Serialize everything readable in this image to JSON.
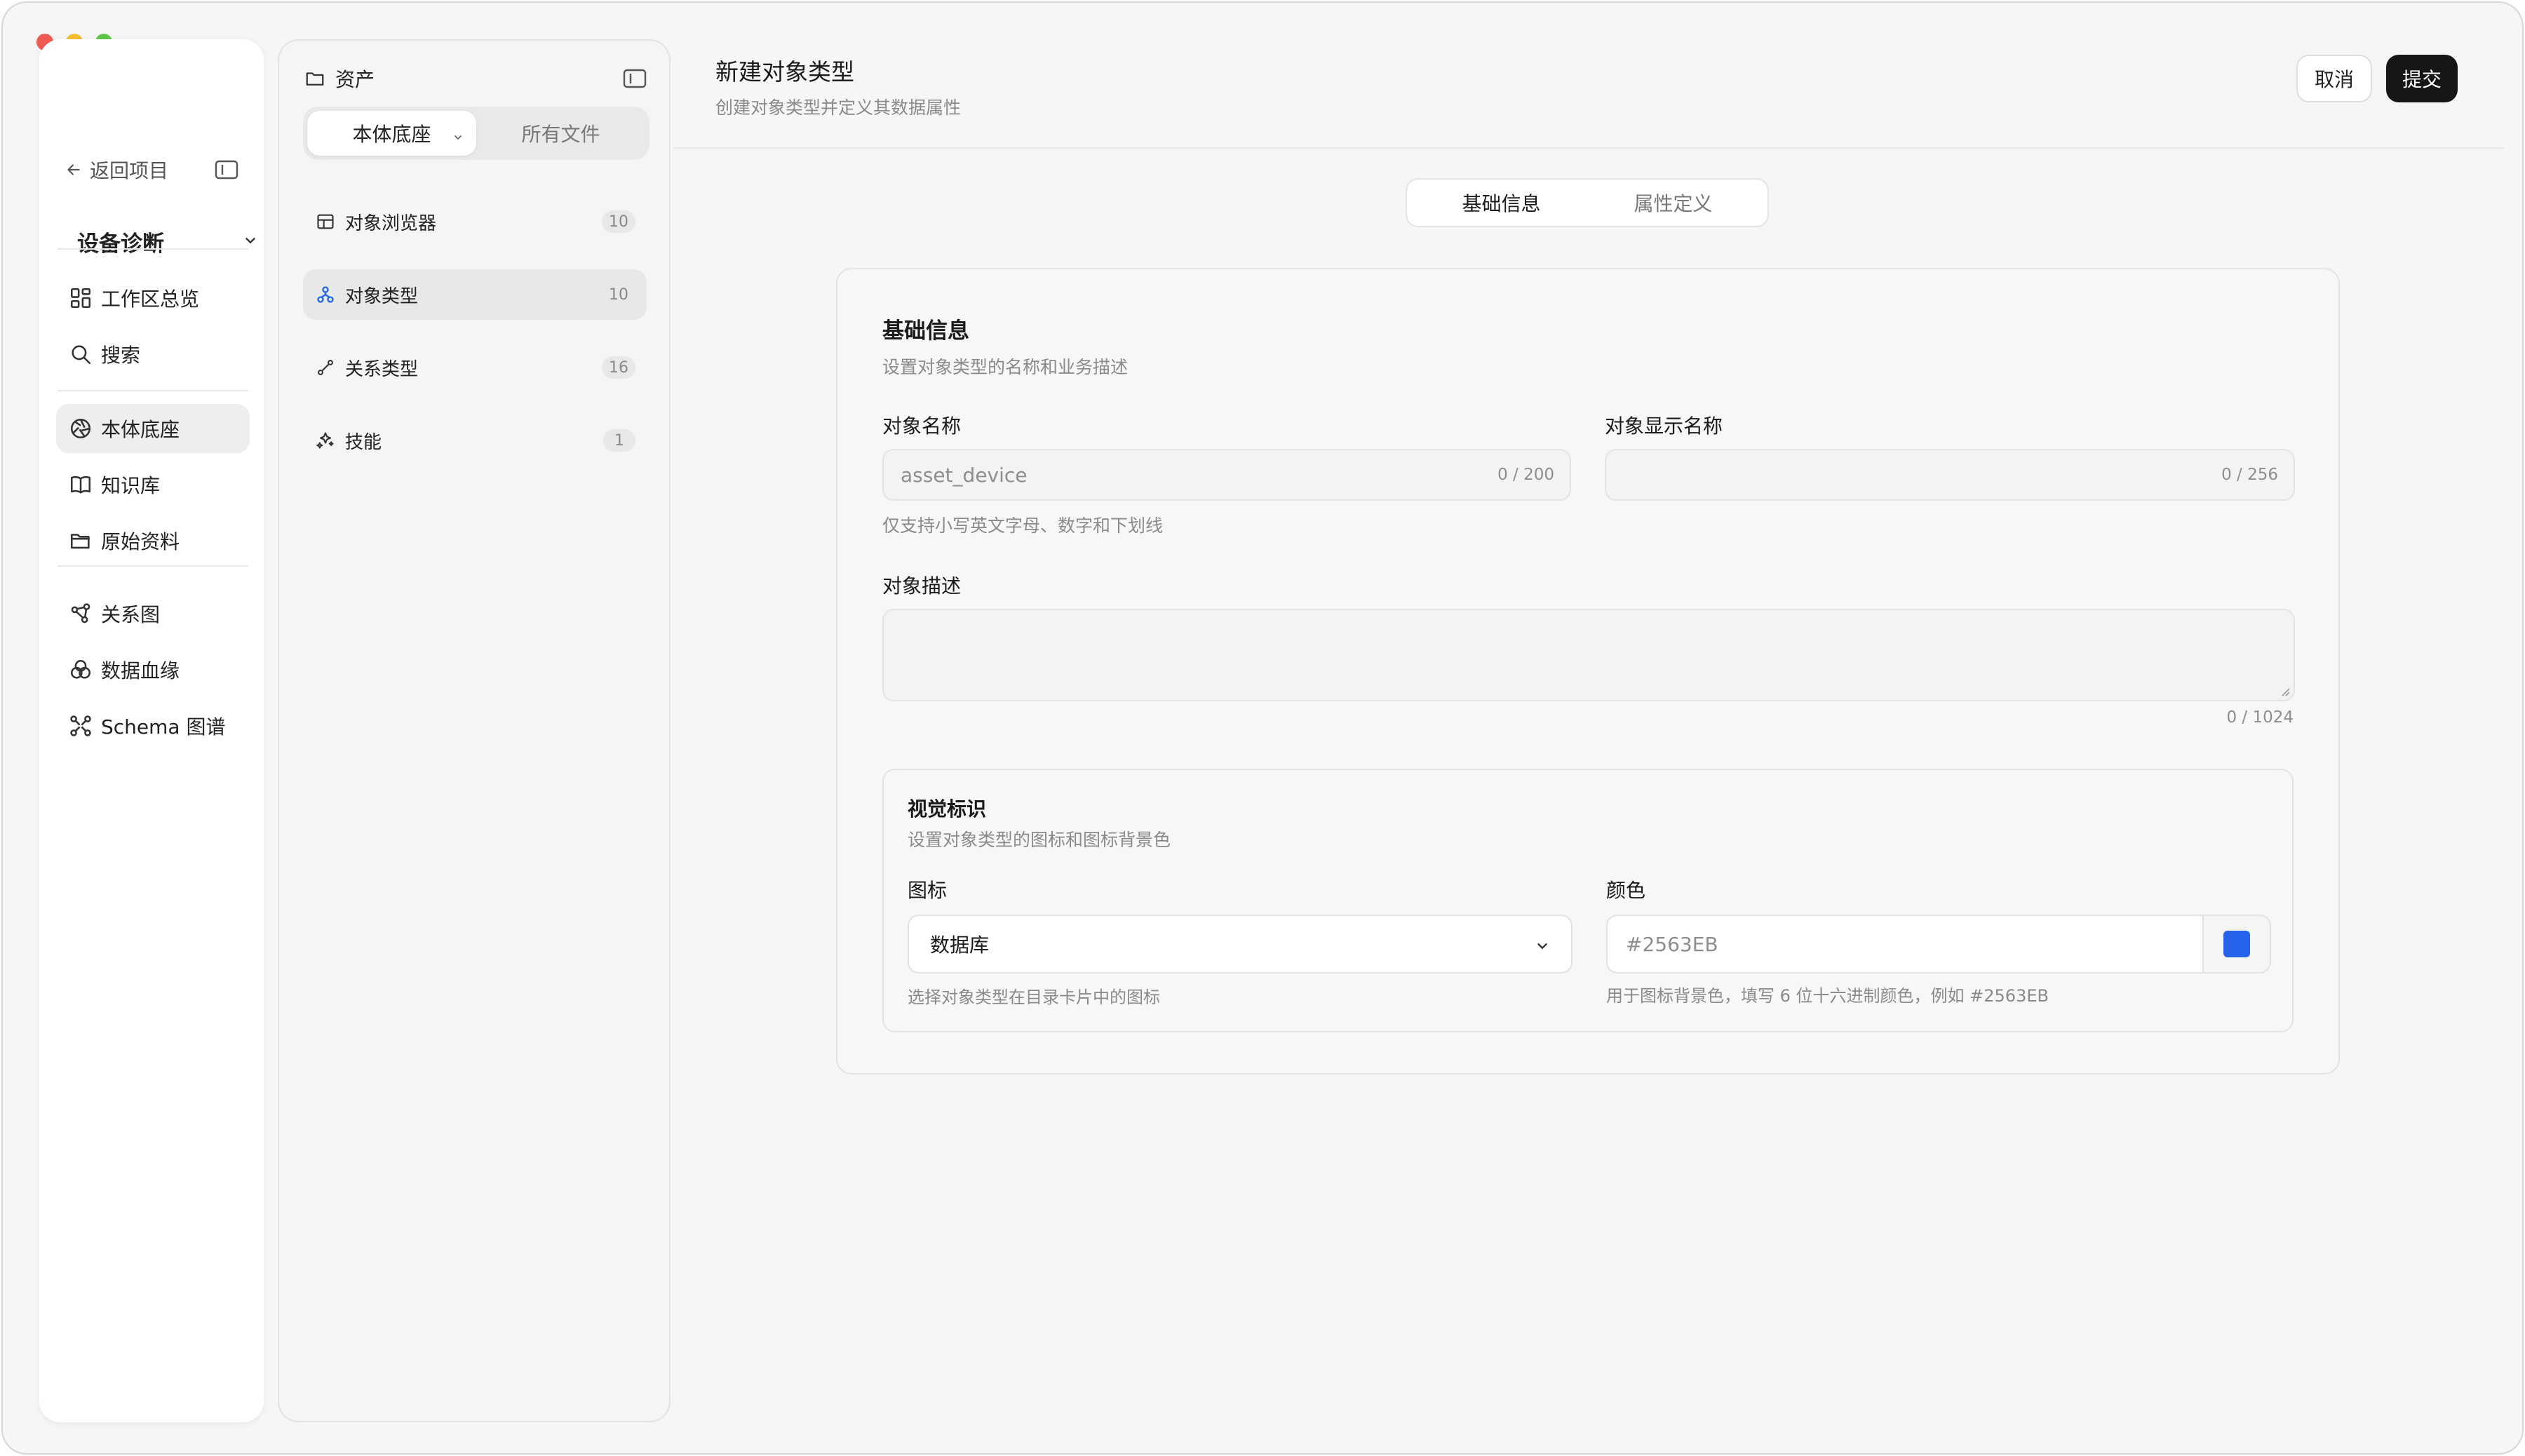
{
  "sidebar": {
    "back_label": "返回项目",
    "project_name": "设备诊断",
    "items": [
      {
        "label": "工作区总览"
      },
      {
        "label": "搜索"
      },
      {
        "label": "本体底座"
      },
      {
        "label": "知识库"
      },
      {
        "label": "原始资料"
      },
      {
        "label": "关系图"
      },
      {
        "label": "数据血缘"
      },
      {
        "label": "Schema 图谱"
      }
    ]
  },
  "panel": {
    "title": "资产",
    "segments": [
      {
        "label": "本体底座"
      },
      {
        "label": "所有文件"
      }
    ],
    "items": [
      {
        "label": "对象浏览器",
        "count": "10"
      },
      {
        "label": "对象类型",
        "count": "10"
      },
      {
        "label": "关系类型",
        "count": "16"
      },
      {
        "label": "技能",
        "count": "1"
      }
    ]
  },
  "header": {
    "title": "新建对象类型",
    "subtitle": "创建对象类型并定义其数据属性",
    "cancel_label": "取消",
    "submit_label": "提交"
  },
  "tabs": [
    {
      "label": "基础信息"
    },
    {
      "label": "属性定义"
    }
  ],
  "form": {
    "section_title": "基础信息",
    "section_subtitle": "设置对象类型的名称和业务描述",
    "name": {
      "label": "对象名称",
      "placeholder": "asset_device",
      "counter": "0 / 200",
      "hint": "仅支持小写英文字母、数字和下划线"
    },
    "display_name": {
      "label": "对象显示名称",
      "placeholder": "",
      "counter": "0 / 256"
    },
    "description": {
      "label": "对象描述",
      "counter": "0 / 1024"
    },
    "visual": {
      "title": "视觉标识",
      "subtitle": "设置对象类型的图标和图标背景色",
      "icon_label": "图标",
      "icon_value": "数据库",
      "icon_hint": "选择对象类型在目录卡片中的图标",
      "color_label": "颜色",
      "color_value": "#2563EB",
      "color_hint": "用于图标背景色，填写 6 位十六进制颜色，例如 #2563EB"
    }
  },
  "colors": {
    "accent": "#2563EB",
    "submit_bg": "#161616"
  }
}
